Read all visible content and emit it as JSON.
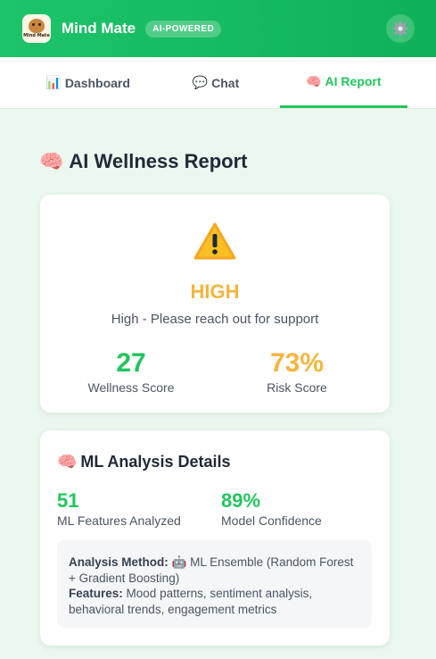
{
  "header": {
    "logo_text": "Mind Mate",
    "app_title": "Mind Mate",
    "badge": "AI-POWERED",
    "settings_icon": "gear-icon"
  },
  "tabs": [
    {
      "icon": "📊",
      "label": "Dashboard",
      "active": false
    },
    {
      "icon": "💬",
      "label": "Chat",
      "active": false
    },
    {
      "icon": "🧠",
      "label": "AI Report",
      "active": true
    }
  ],
  "report": {
    "title_icon": "🧠",
    "title": "AI Wellness Report",
    "risk_icon": "warning-icon",
    "risk_level": "HIGH",
    "risk_description": "High - Please reach out for support",
    "wellness_score": "27",
    "wellness_label": "Wellness Score",
    "risk_score": "73%",
    "risk_label": "Risk Score",
    "risk_fraction": 0.73
  },
  "ml": {
    "title_icon": "🧠",
    "title": "ML Analysis Details",
    "features_value": "51",
    "features_label": "ML Features Analyzed",
    "confidence_value": "89%",
    "confidence_label": "Model Confidence",
    "method_label": "Analysis Method:",
    "method_icon": "🤖",
    "method_value": "ML Ensemble (Random Forest + Gradient Boosting)",
    "features_detail_label": "Features:",
    "features_detail_value": "Mood patterns, sentiment analysis, behavioral trends, engagement metrics"
  },
  "colors": {
    "brand_green": "#22c55e",
    "warning_amber": "#f4b53f"
  }
}
